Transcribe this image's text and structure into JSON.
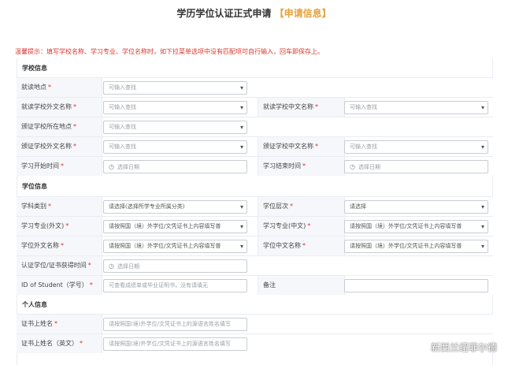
{
  "page": {
    "title": "学历学位认证正式申请",
    "title_highlight": "【申请信息】",
    "tip": "温馨提示：填写学校名称、学习专业、学位名称时，如下拉菜单选项中没有匹配项可自行输入，回车即保存上。"
  },
  "school_section": {
    "heading": "学校信息",
    "study_location": {
      "label": "就读地点",
      "placeholder": "可输入查找"
    },
    "school_foreign_name": {
      "label": "就读学校外文名称",
      "placeholder": "可输入查找"
    },
    "school_chinese_name": {
      "label": "就读学校中文名称",
      "placeholder": "可输入查找"
    },
    "issuing_school_location": {
      "label": "颁证学校所在地点",
      "placeholder": "可输入查找"
    },
    "issuing_school_foreign_name": {
      "label": "颁证学校外文名称",
      "placeholder": "可输入查找"
    },
    "issuing_school_chinese_name": {
      "label": "颁证学校中文名称",
      "placeholder": "可输入查找"
    },
    "study_start": {
      "label": "学习开始时间",
      "placeholder": "选择日期"
    },
    "study_end": {
      "label": "学习结束时间",
      "placeholder": "选择日期"
    }
  },
  "degree_section": {
    "heading": "学位信息",
    "subject_category": {
      "label": "学科类别",
      "value": "请选择(选择所学专业所属分类)"
    },
    "degree_level": {
      "label": "学位层次",
      "value": "请选择"
    },
    "major_foreign": {
      "label": "学习专业(外文)",
      "value": "请按照国（境）外学位/文凭证书上内容填写普"
    },
    "major_chinese": {
      "label": "学习专业(中文)",
      "value": "请按照国（境）外学位/文凭证书上内容填写普"
    },
    "degree_foreign_name": {
      "label": "学位外文名称",
      "value": "请按照国（境）外学位/文凭证书上内容填写普"
    },
    "degree_chinese_name": {
      "label": "学位中文名称",
      "value": "请按照国（境）外学位/文凭证书上内容填写普"
    },
    "certificate_time": {
      "label": "认证学位/证书获得时间",
      "placeholder": "选择日期"
    },
    "student_id": {
      "label": "ID of Student（学号）",
      "placeholder": "可查看成绩单或毕业证明书，没有请填无"
    },
    "remark": {
      "label": "备注",
      "value": ""
    }
  },
  "personal_section": {
    "heading": "个人信息",
    "certificate_name": {
      "label": "证书上姓名",
      "placeholder": "请按照国(境)外学位/文凭证书上的源语言姓名填写"
    },
    "certificate_name_en": {
      "label": "证书上姓名（英文）",
      "placeholder": "请按照国(境)外学位/文凭证书上的源语言姓名填写"
    }
  },
  "watermark": "新西兰纽菲尔德"
}
